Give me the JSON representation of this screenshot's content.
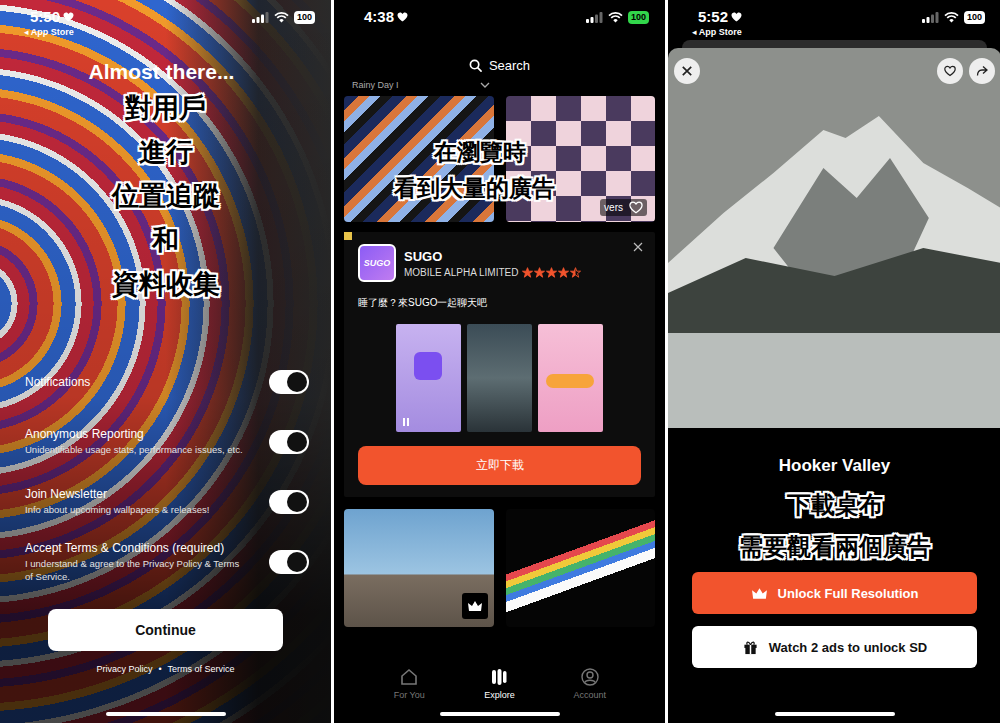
{
  "onboarding": {
    "status_bar": {
      "time": "5:50",
      "back_link": "◂ App Store",
      "battery": "100",
      "charging": false
    },
    "title": "Almost there...",
    "caption_lines": [
      "對用戶",
      "進行",
      "位置追蹤",
      "和",
      "資料收集"
    ],
    "settings": [
      {
        "label": "Notifications",
        "description": "",
        "on": true
      },
      {
        "label": "Anonymous Reporting",
        "description": "Unidentifiable usage stats, performance issues, etc.",
        "on": true
      },
      {
        "label": "Join Newsletter",
        "description": "Info about upcoming wallpapers & releases!",
        "on": true
      },
      {
        "label": "Accept Terms & Conditions (required)",
        "description": "I understand & agree to the Privacy Policy & Terms of Service.",
        "on": true
      }
    ],
    "button": "Continue",
    "footer_links": [
      "Privacy Policy",
      "Terms of Service"
    ],
    "footer_separator": "•"
  },
  "explore": {
    "status_bar": {
      "time": "4:38",
      "battery": "100",
      "charging": true
    },
    "search": {
      "placeholder": "Search"
    },
    "collection_label": "Rainy Day I",
    "caption_lines": [
      "在瀏覽時",
      "看到大量的廣告"
    ],
    "partial_label": "vers",
    "ad": {
      "icon_text": "SUGO",
      "name": "SUGO",
      "publisher": "MOBILE ALPHA LIMITED",
      "stars": 4.5,
      "tagline": "睡了麼？來SUGO一起聊天吧",
      "cta": "立即下載"
    },
    "tabs": [
      {
        "label": "For You",
        "selected": false
      },
      {
        "label": "Explore",
        "selected": true
      },
      {
        "label": "Account",
        "selected": false
      }
    ]
  },
  "detail": {
    "status_bar": {
      "time": "5:52",
      "back_link": "◂ App Store",
      "battery": "100",
      "charging": false
    },
    "title": "Hooker Valley",
    "caption_lines": [
      "下載桌布",
      "需要觀看兩個廣告"
    ],
    "actions": [
      {
        "label": "Unlock Full Resolution",
        "kind": "primary"
      },
      {
        "label": "Watch 2 ads to unlock SD",
        "kind": "secondary"
      }
    ]
  }
}
